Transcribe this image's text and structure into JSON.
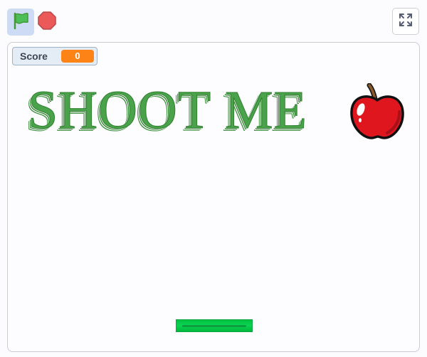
{
  "toolbar": {
    "green_flag_icon": "green-flag-icon",
    "stop_icon": "stop-icon",
    "fullscreen_icon": "fullscreen-icon"
  },
  "stage": {
    "score_monitor": {
      "label": "Score",
      "value": "0"
    },
    "title": "SHOOT ME",
    "sprites": [
      "apple",
      "paddle"
    ]
  },
  "colors": {
    "flag_button_bg": "#cddcf4",
    "title_green": "#4aa34a",
    "score_orange": "#fd8316",
    "paddle_green": "#0bd351",
    "apple_red": "#e0161f"
  }
}
